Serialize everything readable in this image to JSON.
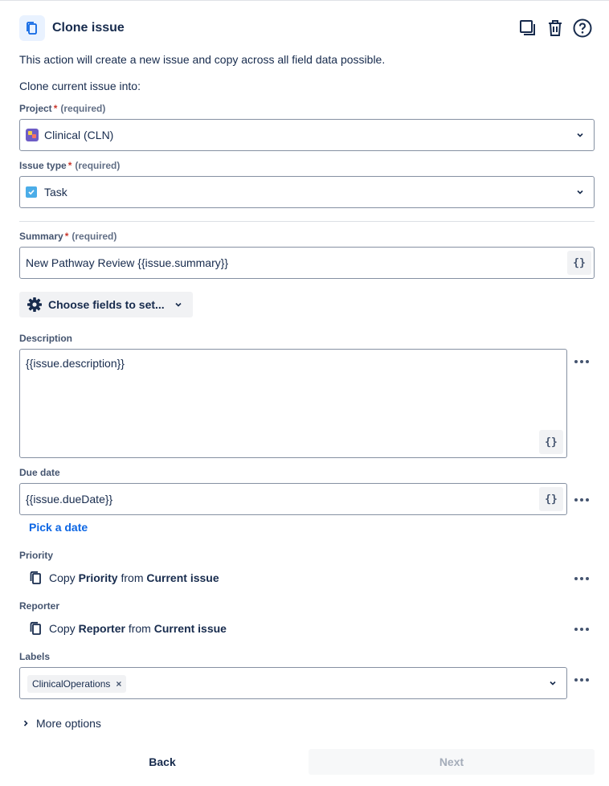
{
  "header": {
    "title": "Clone issue",
    "icons": [
      "copy-icon",
      "duplicate-icon",
      "trash-icon",
      "help-icon"
    ]
  },
  "intro": {
    "description": "This action will create a new issue and copy across all field data possible.",
    "clone_into": "Clone current issue into:"
  },
  "project": {
    "label": "Project",
    "required_mark": "*",
    "required_text": "(required)",
    "value": "Clinical (CLN)"
  },
  "issue_type": {
    "label": "Issue type",
    "required_mark": "*",
    "required_text": "(required)",
    "value": "Task"
  },
  "summary": {
    "label": "Summary",
    "required_mark": "*",
    "required_text": "(required)",
    "value": "New Pathway Review {{issue.summary}}",
    "smart_value_label": "{}"
  },
  "choose_fields": {
    "label": "Choose fields to set..."
  },
  "description_field": {
    "label": "Description",
    "value": "{{issue.description}}",
    "smart_value_label": "{}"
  },
  "due_date": {
    "label": "Due date",
    "value": "{{issue.dueDate}}",
    "smart_value_label": "{}",
    "pick_link": "Pick a date"
  },
  "priority": {
    "label": "Priority",
    "copy_word": "Copy",
    "field_name": "Priority",
    "from_word": "from",
    "source": "Current issue"
  },
  "reporter": {
    "label": "Reporter",
    "copy_word": "Copy",
    "field_name": "Reporter",
    "from_word": "from",
    "source": "Current issue"
  },
  "labels": {
    "label": "Labels",
    "tags": [
      "ClinicalOperations"
    ],
    "remove_glyph": "×"
  },
  "more_options": {
    "label": "More options"
  },
  "footer": {
    "back_label": "Back",
    "next_label": "Next"
  },
  "colors": {
    "accent": "#0c66e4",
    "required": "#c9372c",
    "task_icon": "#4bade8",
    "project_icon": "#6e5dc6"
  }
}
